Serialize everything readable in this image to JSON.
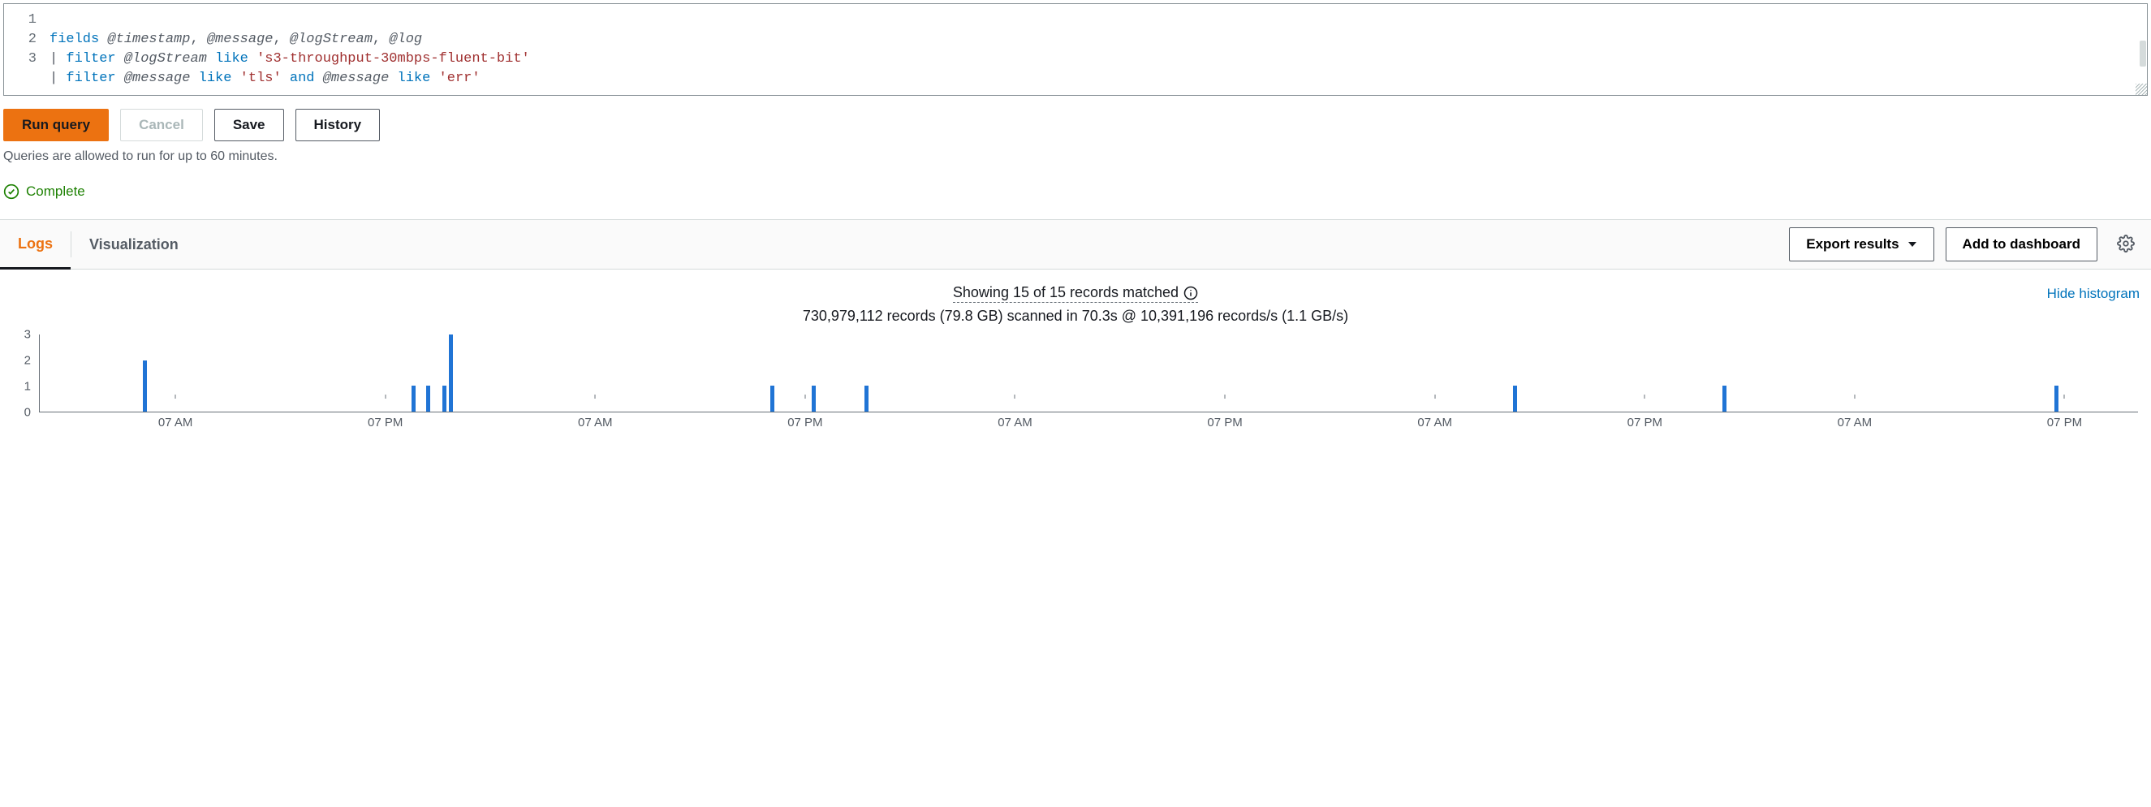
{
  "editor": {
    "lines": [
      "1",
      "2",
      "3"
    ],
    "line1": {
      "t1": "fields ",
      "t2": "@timestamp",
      "t3": ", ",
      "t4": "@message",
      "t5": ", ",
      "t6": "@logStream",
      "t7": ", ",
      "t8": "@log"
    },
    "line2": {
      "t1": "| ",
      "t2": "filter ",
      "t3": "@logStream",
      "t4": " ",
      "t5": "like",
      "t6": " ",
      "t7": "'s3-throughput-30mbps-fluent-bit'"
    },
    "line3": {
      "t1": "| ",
      "t2": "filter ",
      "t3": "@message",
      "t4": " ",
      "t5": "like",
      "t6": " ",
      "t7": "'tls'",
      "t8": " ",
      "t9": "and",
      "t10": " ",
      "t11": "@message",
      "t12": " ",
      "t13": "like",
      "t14": " ",
      "t15": "'err'"
    }
  },
  "buttons": {
    "run": "Run query",
    "cancel": "Cancel",
    "save": "Save",
    "history": "History"
  },
  "note": "Queries are allowed to run for up to 60 minutes.",
  "status": {
    "label": "Complete"
  },
  "tabs": {
    "logs": "Logs",
    "viz": "Visualization"
  },
  "actions": {
    "export": "Export results",
    "add": "Add to dashboard"
  },
  "summary": {
    "line1": "Showing 15 of 15 records matched",
    "line2": "730,979,112 records (79.8 GB) scanned in 70.3s @ 10,391,196 records/s (1.1 GB/s)",
    "hide": "Hide histogram"
  },
  "chart_data": {
    "type": "bar",
    "ylim": [
      0,
      3
    ],
    "yticks": [
      0,
      1,
      2,
      3
    ],
    "xticks": [
      "07 AM",
      "07 PM",
      "07 AM",
      "07 PM",
      "07 AM",
      "07 PM",
      "07 AM",
      "07 PM",
      "07 AM",
      "07 PM"
    ],
    "xtick_pos_pct": [
      6.5,
      16.5,
      26.5,
      36.5,
      46.5,
      56.5,
      66.5,
      76.5,
      86.5,
      96.5
    ],
    "bars": [
      {
        "x_pct": 4.9,
        "value": 2
      },
      {
        "x_pct": 17.7,
        "value": 1
      },
      {
        "x_pct": 18.4,
        "value": 1
      },
      {
        "x_pct": 19.2,
        "value": 1
      },
      {
        "x_pct": 19.5,
        "value": 3
      },
      {
        "x_pct": 34.8,
        "value": 1
      },
      {
        "x_pct": 36.8,
        "value": 1
      },
      {
        "x_pct": 39.3,
        "value": 1
      },
      {
        "x_pct": 70.2,
        "value": 1
      },
      {
        "x_pct": 80.2,
        "value": 1
      },
      {
        "x_pct": 96.0,
        "value": 1
      }
    ]
  }
}
